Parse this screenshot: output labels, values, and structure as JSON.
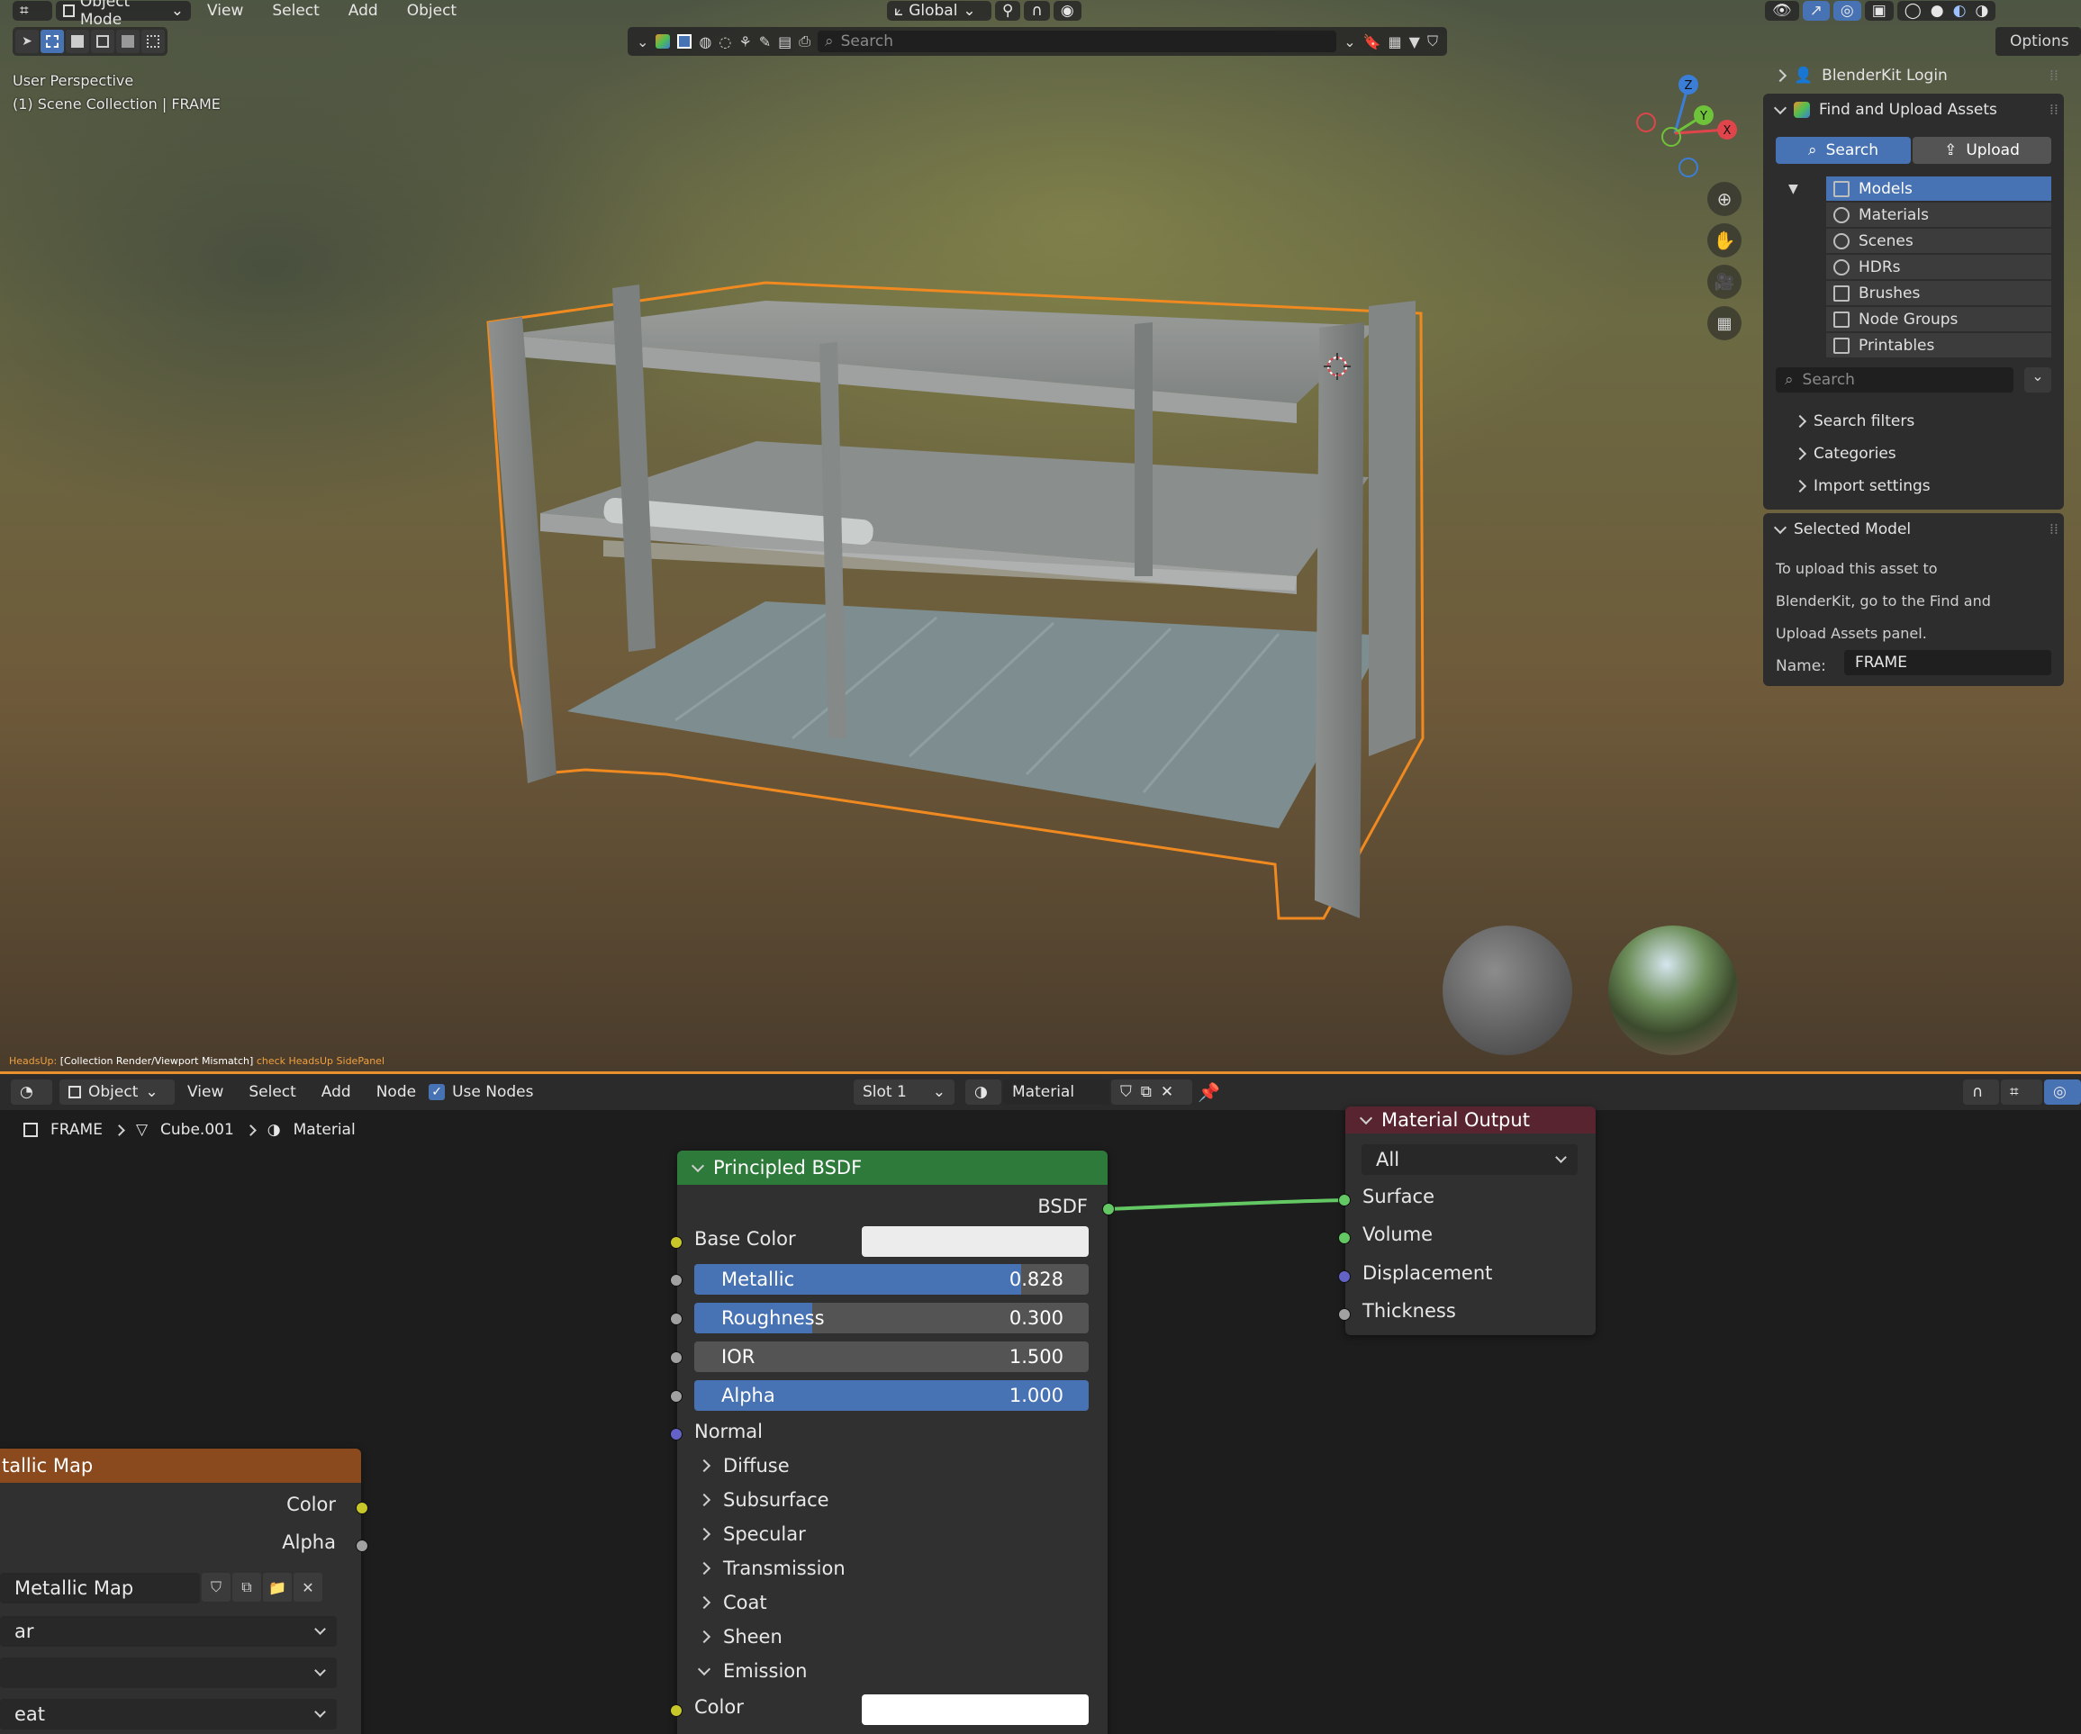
{
  "viewport": {
    "menu": {
      "mode": "Object Mode",
      "view": "View",
      "select": "Select",
      "add": "Add",
      "object": "Object"
    },
    "transform_orientation": "Global",
    "search_placeholder": "Search",
    "options_label": "Options",
    "overlay": {
      "perspective": "User Perspective",
      "collection": "(1) Scene Collection | FRAME"
    },
    "gizmo_axes": {
      "z": "Z",
      "y": "Y",
      "x": "X"
    },
    "headsup": {
      "prefix": "HeadsUp:",
      "message": "[Collection Render/Viewport Mismatch]",
      "suffix": "check HeadsUp SidePanel"
    }
  },
  "npanel": {
    "login": "BlenderKit Login",
    "find_upload": "Find and Upload Assets",
    "search_tab": "Search",
    "upload_tab": "Upload",
    "categories": [
      {
        "label": "Models",
        "icon": "cube-icon"
      },
      {
        "label": "Materials",
        "icon": "material-sphere-icon"
      },
      {
        "label": "Scenes",
        "icon": "scene-icon"
      },
      {
        "label": "HDRs",
        "icon": "world-icon"
      },
      {
        "label": "Brushes",
        "icon": "brush-icon"
      },
      {
        "label": "Node Groups",
        "icon": "node-tree-icon"
      },
      {
        "label": "Printables",
        "icon": "printer-icon"
      }
    ],
    "search_placeholder": "Search",
    "search_filters": "Search filters",
    "categories_label": "Categories",
    "import_settings": "Import settings",
    "selected_model": "Selected Model",
    "upload_text": [
      "To upload this asset to",
      "BlenderKit, go to the Find and",
      "Upload Assets panel."
    ],
    "name_label": "Name:",
    "name_value": "FRAME"
  },
  "node_editor": {
    "header": {
      "object": "Object",
      "view": "View",
      "select": "Select",
      "add": "Add",
      "node": "Node",
      "use_nodes": "Use Nodes",
      "slot": "Slot 1",
      "material": "Material"
    },
    "breadcrumb": {
      "object": "FRAME",
      "mesh": "Cube.001",
      "material": "Material"
    },
    "principled": {
      "title": "Principled BSDF",
      "output": "BSDF",
      "base_color": "Base Color",
      "metallic": {
        "label": "Metallic",
        "value": "0.828",
        "fraction": 0.828
      },
      "roughness": {
        "label": "Roughness",
        "value": "0.300",
        "fraction": 0.3
      },
      "ior": {
        "label": "IOR",
        "value": "1.500"
      },
      "alpha": {
        "label": "Alpha",
        "value": "1.000",
        "fraction": 1.0
      },
      "normal": "Normal",
      "panels": [
        "Diffuse",
        "Subsurface",
        "Specular",
        "Transmission",
        "Coat",
        "Sheen"
      ],
      "emission": "Emission",
      "emission_color": "Color"
    },
    "material_output": {
      "title": "Material Output",
      "target": "All",
      "inputs": [
        "Surface",
        "Volume",
        "Displacement",
        "Thickness"
      ]
    },
    "metallic_map": {
      "title": "tallic Map",
      "color": "Color",
      "alpha": "Alpha",
      "image_name": "Metallic Map",
      "dd1": "ar",
      "dd2": "",
      "dd3": "eat"
    }
  }
}
